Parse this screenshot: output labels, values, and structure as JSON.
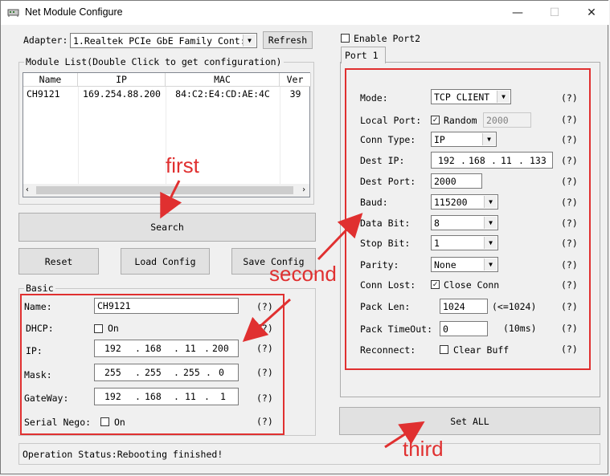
{
  "window": {
    "title": "Net Module Configure",
    "controls": {
      "minimize": "—",
      "maximize": "☐",
      "close": "✕"
    }
  },
  "adapter": {
    "label": "Adapter:",
    "value": "1.Realtek PCIe GbE Family Cont:",
    "refresh_label": "Refresh"
  },
  "module_list": {
    "title": "Module List(Double Click to get configuration)",
    "columns": [
      "Name",
      "IP",
      "MAC",
      "Ver"
    ],
    "rows": [
      {
        "name": "CH9121",
        "ip": "169.254.88.200",
        "mac": "84:C2:E4:CD:AE:4C",
        "ver": "39"
      }
    ]
  },
  "buttons": {
    "search": "Search",
    "reset": "Reset",
    "load_config": "Load Config",
    "save_config": "Save Config",
    "set_all": "Set ALL"
  },
  "basic": {
    "title": "Basic",
    "name_label": "Name:",
    "name_value": "CH9121",
    "dhcp_label": "DHCP:",
    "dhcp_on_label": "On",
    "dhcp_checked": false,
    "ip_label": "IP:",
    "ip": [
      "192",
      "168",
      "11",
      "200"
    ],
    "mask_label": "Mask:",
    "mask": [
      "255",
      "255",
      "255",
      "0"
    ],
    "gateway_label": "GateWay:",
    "gateway": [
      "192",
      "168",
      "11",
      "1"
    ],
    "serial_nego_label": "Serial Nego:",
    "serial_nego_on_label": "On",
    "serial_nego_checked": false,
    "hint": "(?)"
  },
  "port": {
    "enable_port2_label": "Enable Port2",
    "enable_port2_checked": false,
    "tab_label": "Port 1",
    "mode_label": "Mode:",
    "mode_value": "TCP CLIENT",
    "local_port_label": "Local Port:",
    "random_label": "Random",
    "random_checked": true,
    "local_port_value": "2000",
    "conn_type_label": "Conn Type:",
    "conn_type_value": "IP",
    "dest_ip_label": "Dest IP:",
    "dest_ip": [
      "192",
      "168",
      "11",
      "133"
    ],
    "dest_port_label": "Dest Port:",
    "dest_port_value": "2000",
    "baud_label": "Baud:",
    "baud_value": "115200",
    "data_bit_label": "Data Bit:",
    "data_bit_value": "8",
    "stop_bit_label": "Stop Bit:",
    "stop_bit_value": "1",
    "parity_label": "Parity:",
    "parity_value": "None",
    "conn_lost_label": "Conn Lost:",
    "close_conn_label": "Close Conn",
    "close_conn_checked": true,
    "pack_len_label": "Pack Len:",
    "pack_len_value": "1024",
    "pack_len_hint": "(<=1024)",
    "pack_timeout_label": "Pack TimeOut:",
    "pack_timeout_value": "0",
    "pack_timeout_hint": "(10ms)",
    "reconnect_label": "Reconnect:",
    "clear_buff_label": "Clear Buff",
    "clear_buff_checked": false,
    "hint": "(?)"
  },
  "status": {
    "text": "Operation Status:Rebooting finished!"
  },
  "annotations": {
    "first": "first",
    "second": "second",
    "third": "third",
    "color": "#e03030"
  }
}
